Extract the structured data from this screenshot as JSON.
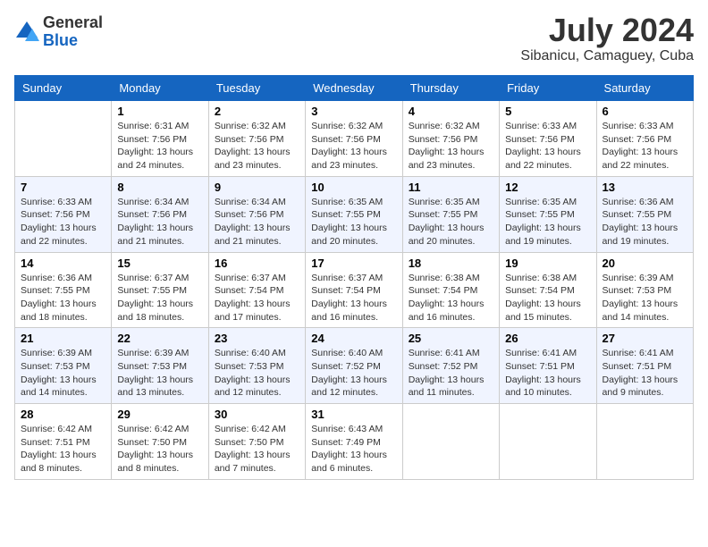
{
  "logo": {
    "general": "General",
    "blue": "Blue"
  },
  "title": {
    "month_year": "July 2024",
    "location": "Sibanicu, Camaguey, Cuba"
  },
  "days_of_week": [
    "Sunday",
    "Monday",
    "Tuesday",
    "Wednesday",
    "Thursday",
    "Friday",
    "Saturday"
  ],
  "weeks": [
    [
      {
        "day": "",
        "info": ""
      },
      {
        "day": "1",
        "info": "Sunrise: 6:31 AM\nSunset: 7:56 PM\nDaylight: 13 hours\nand 24 minutes."
      },
      {
        "day": "2",
        "info": "Sunrise: 6:32 AM\nSunset: 7:56 PM\nDaylight: 13 hours\nand 23 minutes."
      },
      {
        "day": "3",
        "info": "Sunrise: 6:32 AM\nSunset: 7:56 PM\nDaylight: 13 hours\nand 23 minutes."
      },
      {
        "day": "4",
        "info": "Sunrise: 6:32 AM\nSunset: 7:56 PM\nDaylight: 13 hours\nand 23 minutes."
      },
      {
        "day": "5",
        "info": "Sunrise: 6:33 AM\nSunset: 7:56 PM\nDaylight: 13 hours\nand 22 minutes."
      },
      {
        "day": "6",
        "info": "Sunrise: 6:33 AM\nSunset: 7:56 PM\nDaylight: 13 hours\nand 22 minutes."
      }
    ],
    [
      {
        "day": "7",
        "info": "Sunrise: 6:33 AM\nSunset: 7:56 PM\nDaylight: 13 hours\nand 22 minutes."
      },
      {
        "day": "8",
        "info": "Sunrise: 6:34 AM\nSunset: 7:56 PM\nDaylight: 13 hours\nand 21 minutes."
      },
      {
        "day": "9",
        "info": "Sunrise: 6:34 AM\nSunset: 7:56 PM\nDaylight: 13 hours\nand 21 minutes."
      },
      {
        "day": "10",
        "info": "Sunrise: 6:35 AM\nSunset: 7:55 PM\nDaylight: 13 hours\nand 20 minutes."
      },
      {
        "day": "11",
        "info": "Sunrise: 6:35 AM\nSunset: 7:55 PM\nDaylight: 13 hours\nand 20 minutes."
      },
      {
        "day": "12",
        "info": "Sunrise: 6:35 AM\nSunset: 7:55 PM\nDaylight: 13 hours\nand 19 minutes."
      },
      {
        "day": "13",
        "info": "Sunrise: 6:36 AM\nSunset: 7:55 PM\nDaylight: 13 hours\nand 19 minutes."
      }
    ],
    [
      {
        "day": "14",
        "info": "Sunrise: 6:36 AM\nSunset: 7:55 PM\nDaylight: 13 hours\nand 18 minutes."
      },
      {
        "day": "15",
        "info": "Sunrise: 6:37 AM\nSunset: 7:55 PM\nDaylight: 13 hours\nand 18 minutes."
      },
      {
        "day": "16",
        "info": "Sunrise: 6:37 AM\nSunset: 7:54 PM\nDaylight: 13 hours\nand 17 minutes."
      },
      {
        "day": "17",
        "info": "Sunrise: 6:37 AM\nSunset: 7:54 PM\nDaylight: 13 hours\nand 16 minutes."
      },
      {
        "day": "18",
        "info": "Sunrise: 6:38 AM\nSunset: 7:54 PM\nDaylight: 13 hours\nand 16 minutes."
      },
      {
        "day": "19",
        "info": "Sunrise: 6:38 AM\nSunset: 7:54 PM\nDaylight: 13 hours\nand 15 minutes."
      },
      {
        "day": "20",
        "info": "Sunrise: 6:39 AM\nSunset: 7:53 PM\nDaylight: 13 hours\nand 14 minutes."
      }
    ],
    [
      {
        "day": "21",
        "info": "Sunrise: 6:39 AM\nSunset: 7:53 PM\nDaylight: 13 hours\nand 14 minutes."
      },
      {
        "day": "22",
        "info": "Sunrise: 6:39 AM\nSunset: 7:53 PM\nDaylight: 13 hours\nand 13 minutes."
      },
      {
        "day": "23",
        "info": "Sunrise: 6:40 AM\nSunset: 7:53 PM\nDaylight: 13 hours\nand 12 minutes."
      },
      {
        "day": "24",
        "info": "Sunrise: 6:40 AM\nSunset: 7:52 PM\nDaylight: 13 hours\nand 12 minutes."
      },
      {
        "day": "25",
        "info": "Sunrise: 6:41 AM\nSunset: 7:52 PM\nDaylight: 13 hours\nand 11 minutes."
      },
      {
        "day": "26",
        "info": "Sunrise: 6:41 AM\nSunset: 7:51 PM\nDaylight: 13 hours\nand 10 minutes."
      },
      {
        "day": "27",
        "info": "Sunrise: 6:41 AM\nSunset: 7:51 PM\nDaylight: 13 hours\nand 9 minutes."
      }
    ],
    [
      {
        "day": "28",
        "info": "Sunrise: 6:42 AM\nSunset: 7:51 PM\nDaylight: 13 hours\nand 8 minutes."
      },
      {
        "day": "29",
        "info": "Sunrise: 6:42 AM\nSunset: 7:50 PM\nDaylight: 13 hours\nand 8 minutes."
      },
      {
        "day": "30",
        "info": "Sunrise: 6:42 AM\nSunset: 7:50 PM\nDaylight: 13 hours\nand 7 minutes."
      },
      {
        "day": "31",
        "info": "Sunrise: 6:43 AM\nSunset: 7:49 PM\nDaylight: 13 hours\nand 6 minutes."
      },
      {
        "day": "",
        "info": ""
      },
      {
        "day": "",
        "info": ""
      },
      {
        "day": "",
        "info": ""
      }
    ]
  ]
}
